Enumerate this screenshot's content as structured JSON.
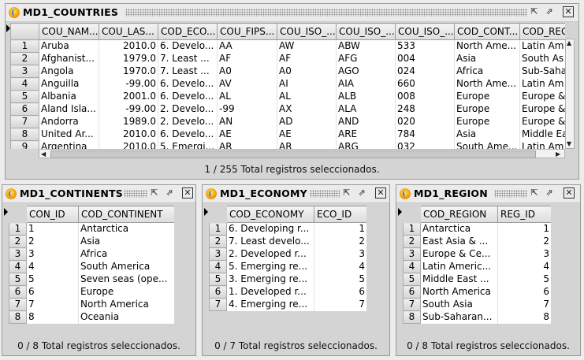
{
  "countries": {
    "title": "MD1_COUNTRIES",
    "columns": [
      "COU_NAM...",
      "COU_LAS...",
      "COD_ECO...",
      "COU_FIPS...",
      "COU_ISO_...",
      "COU_ISO_...",
      "COU_ISO_...",
      "COD_CONT...",
      "COD_REG"
    ],
    "rows": [
      [
        "1",
        "Aruba",
        "2010.0",
        "6. Develo...",
        "AA",
        "AW",
        "ABW",
        "533",
        "North Ame...",
        "Latin Am"
      ],
      [
        "2",
        "Afghanist...",
        "1979.0",
        "7. Least ...",
        "AF",
        "AF",
        "AFG",
        "004",
        "Asia",
        "South As"
      ],
      [
        "3",
        "Angola",
        "1970.0",
        "7. Least ...",
        "A0",
        "A0",
        "AGO",
        "024",
        "Africa",
        "Sub-Saha"
      ],
      [
        "4",
        "Anguilla",
        "-99.00",
        "6. Develo...",
        "AV",
        "AI",
        "AIA",
        "660",
        "North Ame...",
        "Latin Am"
      ],
      [
        "5",
        "Albania",
        "2001.0",
        "6. Develo...",
        "AL",
        "AL",
        "ALB",
        "008",
        "Europe",
        "Europe &"
      ],
      [
        "6",
        "Aland Isla...",
        "-99.00",
        "2. Develo...",
        "-99",
        "AX",
        "ALA",
        "248",
        "Europe",
        "Europe &"
      ],
      [
        "7",
        "Andorra",
        "1989.0",
        "2. Develo...",
        "AN",
        "AD",
        "AND",
        "020",
        "Europe",
        "Europe &"
      ],
      [
        "8",
        "United Ar...",
        "2010.0",
        "6. Develo...",
        "AE",
        "AE",
        "ARE",
        "784",
        "Asia",
        "Middle Ea"
      ],
      [
        "9",
        "Argentina",
        "2010.0",
        "5. Emergi...",
        "AR",
        "AR",
        "ARG",
        "032",
        "South Ame...",
        "Latin Am"
      ]
    ],
    "status": "1 / 255 Total registros seleccionados."
  },
  "continents": {
    "title": "MD1_CONTINENTS",
    "columns": [
      "CON_ID",
      "COD_CONTINENT"
    ],
    "rows": [
      [
        "1",
        "1",
        "Antarctica"
      ],
      [
        "2",
        "2",
        "Asia"
      ],
      [
        "3",
        "3",
        "Africa"
      ],
      [
        "4",
        "4",
        "South America"
      ],
      [
        "5",
        "5",
        "Seven seas (ope..."
      ],
      [
        "6",
        "6",
        "Europe"
      ],
      [
        "7",
        "7",
        "North America"
      ],
      [
        "8",
        "8",
        "Oceania"
      ]
    ],
    "status": "0 / 8 Total registros seleccionados."
  },
  "economy": {
    "title": "MD1_ECONOMY",
    "columns": [
      "COD_ECONOMY",
      "ECO_ID"
    ],
    "rows": [
      [
        "1",
        "6. Developing r...",
        "1"
      ],
      [
        "2",
        "7. Least develo...",
        "2"
      ],
      [
        "3",
        "2. Developed r...",
        "3"
      ],
      [
        "4",
        "5. Emerging re...",
        "4"
      ],
      [
        "5",
        "3. Emerging re...",
        "5"
      ],
      [
        "6",
        "1. Developed r...",
        "6"
      ],
      [
        "7",
        "4. Emerging re...",
        "7"
      ]
    ],
    "status": "0 / 7 Total registros seleccionados."
  },
  "region": {
    "title": "MD1_REGION",
    "columns": [
      "COD_REGION",
      "REG_ID"
    ],
    "rows": [
      [
        "1",
        "Antarctica",
        "1"
      ],
      [
        "2",
        "East Asia & ...",
        "2"
      ],
      [
        "3",
        "Europe & Ce...",
        "3"
      ],
      [
        "4",
        "Latin Americ...",
        "4"
      ],
      [
        "5",
        "Middle East ...",
        "5"
      ],
      [
        "6",
        "North America",
        "6"
      ],
      [
        "7",
        "South Asia",
        "7"
      ],
      [
        "8",
        "Sub-Saharan...",
        "8"
      ]
    ],
    "status": "0 / 8 Total registros seleccionados."
  },
  "window_buttons": {
    "minimize": "⇱",
    "maximize": "⇗",
    "close": "✕"
  }
}
